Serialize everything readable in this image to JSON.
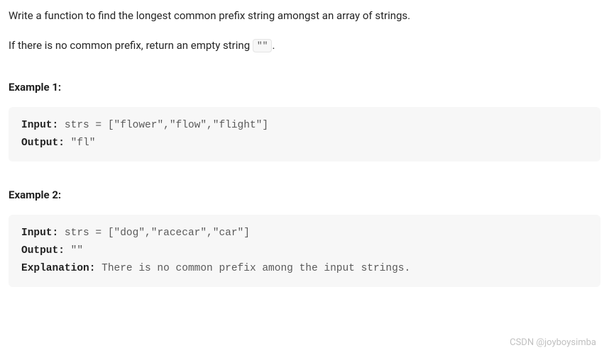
{
  "description": {
    "line1": "Write a function to find the longest common prefix string amongst an array of strings.",
    "line2_pre": "If there is no common prefix, return an empty string ",
    "line2_code": "\"\"",
    "line2_post": "."
  },
  "examples": [
    {
      "heading": "Example 1:",
      "lines": [
        {
          "label": "Input:",
          "value": " strs = [\"flower\",\"flow\",\"flight\"]"
        },
        {
          "label": "Output:",
          "value": " \"fl\""
        }
      ]
    },
    {
      "heading": "Example 2:",
      "lines": [
        {
          "label": "Input:",
          "value": " strs = [\"dog\",\"racecar\",\"car\"]"
        },
        {
          "label": "Output:",
          "value": " \"\""
        },
        {
          "label": "Explanation:",
          "value": " There is no common prefix among the input strings."
        }
      ]
    }
  ],
  "watermark": "CSDN @joyboysimba"
}
